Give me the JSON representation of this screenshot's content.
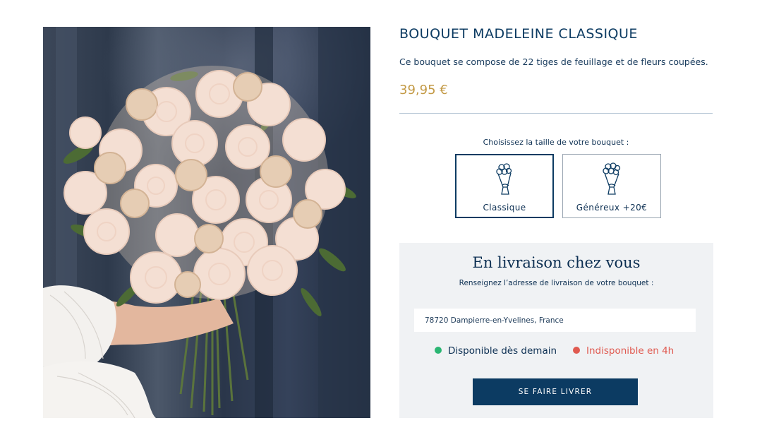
{
  "product": {
    "title": "BOUQUET MADELEINE CLASSIQUE",
    "description": "Ce bouquet se compose de 22 tiges de feuillage et de fleurs coupées.",
    "price": "39,95 €"
  },
  "size_selector": {
    "label": "Choisissez la taille de votre bouquet :",
    "options": [
      {
        "label": "Classique",
        "selected": true
      },
      {
        "label": "Généreux +20€",
        "selected": false
      }
    ]
  },
  "delivery": {
    "title": "En livraison chez vous",
    "subtitle": "Renseignez l’adresse de livraison de votre bouquet :",
    "address_value": "78720 Dampierre-en-Yvelines, France",
    "availability": [
      {
        "label": "Disponible dès demain",
        "color": "#2bb673"
      },
      {
        "label": "Indisponible en 4h",
        "color": "#e05a50"
      }
    ],
    "button_label": "SE FAIRE LIVRER"
  },
  "colors": {
    "brand_navy": "#0c3b62",
    "price_gold": "#c39a46",
    "panel_bg": "#f0f2f4"
  }
}
